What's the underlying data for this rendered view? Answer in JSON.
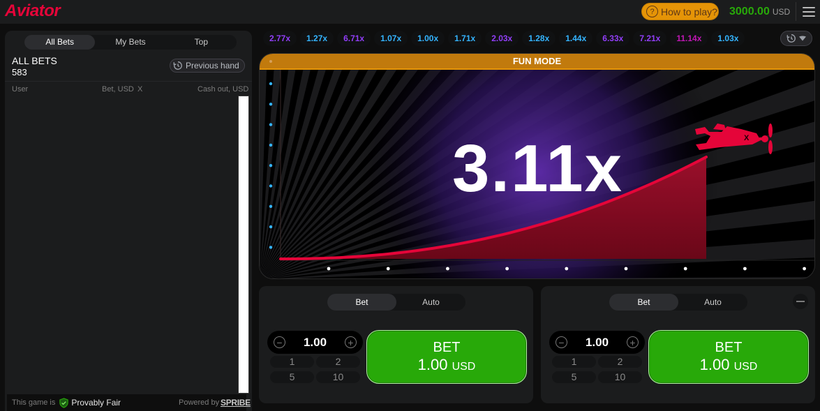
{
  "header": {
    "logo": "Aviator",
    "how_to_play": "How to play?",
    "balance_amount": "3000.00",
    "balance_currency": "USD",
    "colors": {
      "brand": "#e50539",
      "how_to_play_bg": "#e59407",
      "balance": "#28a909"
    }
  },
  "bets_panel": {
    "tabs": [
      {
        "label": "All Bets",
        "active": true
      },
      {
        "label": "My Bets",
        "active": false
      },
      {
        "label": "Top",
        "active": false
      }
    ],
    "title": "ALL BETS",
    "count": "583",
    "previous_hand": "Previous hand",
    "columns": {
      "user": "User",
      "bet": "Bet, USD",
      "x": "X",
      "cashout": "Cash out, USD"
    },
    "rows": [],
    "footer": {
      "prefix": "This game is",
      "provably_fair": "Provably Fair",
      "powered_by": "Powered by",
      "provider": "SPRIBE"
    }
  },
  "history": {
    "multipliers": [
      {
        "value": "2.77x",
        "color": "#913ef8"
      },
      {
        "value": "1.27x",
        "color": "#34b4ff"
      },
      {
        "value": "6.71x",
        "color": "#913ef8"
      },
      {
        "value": "1.07x",
        "color": "#34b4ff"
      },
      {
        "value": "1.00x",
        "color": "#34b4ff"
      },
      {
        "value": "1.71x",
        "color": "#34b4ff"
      },
      {
        "value": "2.03x",
        "color": "#913ef8"
      },
      {
        "value": "1.28x",
        "color": "#34b4ff"
      },
      {
        "value": "1.44x",
        "color": "#34b4ff"
      },
      {
        "value": "6.33x",
        "color": "#913ef8"
      },
      {
        "value": "7.21x",
        "color": "#913ef8"
      },
      {
        "value": "11.14x",
        "color": "#c017b4"
      },
      {
        "value": "1.03x",
        "color": "#34b4ff"
      }
    ]
  },
  "game": {
    "mode_label": "FUN MODE",
    "current_multiplier": "3.11x",
    "colors": {
      "curve": "#e50539",
      "fill": "#7a0d1f",
      "axis_dots_y": "#34b4ff",
      "axis_dots_x": "#ffffff"
    }
  },
  "bet_controls": [
    {
      "tabs": [
        {
          "label": "Bet",
          "active": true
        },
        {
          "label": "Auto",
          "active": false
        }
      ],
      "amount": "1.00",
      "quick_amounts": [
        "1",
        "2",
        "5",
        "10"
      ],
      "button_title": "BET",
      "button_amount": "1.00",
      "button_currency": "USD",
      "removable": false
    },
    {
      "tabs": [
        {
          "label": "Bet",
          "active": true
        },
        {
          "label": "Auto",
          "active": false
        }
      ],
      "amount": "1.00",
      "quick_amounts": [
        "1",
        "2",
        "5",
        "10"
      ],
      "button_title": "BET",
      "button_amount": "1.00",
      "button_currency": "USD",
      "removable": true
    }
  ]
}
